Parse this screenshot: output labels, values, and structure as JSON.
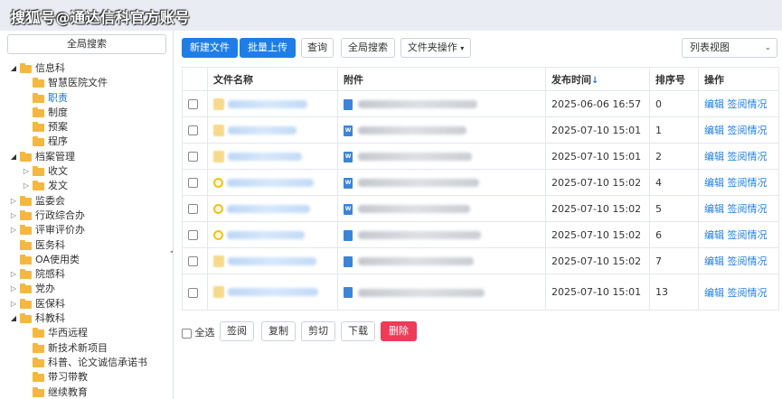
{
  "watermark": "搜狐号@通达信科官方账号",
  "sidebar": {
    "search_label": "全局搜索",
    "tree": [
      {
        "label": "信息科",
        "depth": 0,
        "toggle": "open"
      },
      {
        "label": "智慧医院文件",
        "depth": 1,
        "toggle": "none"
      },
      {
        "label": "职责",
        "depth": 1,
        "toggle": "none",
        "selected": true
      },
      {
        "label": "制度",
        "depth": 1,
        "toggle": "none"
      },
      {
        "label": "预案",
        "depth": 1,
        "toggle": "none"
      },
      {
        "label": "程序",
        "depth": 1,
        "toggle": "none"
      },
      {
        "label": "档案管理",
        "depth": 0,
        "toggle": "open"
      },
      {
        "label": "收文",
        "depth": 1,
        "toggle": "closed"
      },
      {
        "label": "发文",
        "depth": 1,
        "toggle": "closed"
      },
      {
        "label": "监委会",
        "depth": 0,
        "toggle": "closed"
      },
      {
        "label": "行政综合办",
        "depth": 0,
        "toggle": "closed"
      },
      {
        "label": "评审评价办",
        "depth": 0,
        "toggle": "closed"
      },
      {
        "label": "医务科",
        "depth": 0,
        "toggle": "none"
      },
      {
        "label": "OA使用类",
        "depth": 0,
        "toggle": "none"
      },
      {
        "label": "院感科",
        "depth": 0,
        "toggle": "closed"
      },
      {
        "label": "党办",
        "depth": 0,
        "toggle": "closed"
      },
      {
        "label": "医保科",
        "depth": 0,
        "toggle": "closed"
      },
      {
        "label": "科教科",
        "depth": 0,
        "toggle": "open"
      },
      {
        "label": "华西远程",
        "depth": 1,
        "toggle": "none"
      },
      {
        "label": "新技术新项目",
        "depth": 1,
        "toggle": "none"
      },
      {
        "label": "科普、论文诚信承诺书",
        "depth": 1,
        "toggle": "none"
      },
      {
        "label": "带习带教",
        "depth": 1,
        "toggle": "none"
      },
      {
        "label": "继续教育",
        "depth": 1,
        "toggle": "none"
      }
    ]
  },
  "toolbar": {
    "new_file": "新建文件",
    "batch_upload": "批量上传",
    "query": "查询",
    "global_search": "全局搜索",
    "folder_ops": "文件夹操作",
    "view_select": "列表视图"
  },
  "table": {
    "headers": {
      "name": "文件名称",
      "attachment": "附件",
      "publish_time": "发布时间",
      "sort_arrow": "↓",
      "order": "排序号",
      "ops": "操作"
    },
    "rows": [
      {
        "time": "2025-06-06 16:57",
        "order": "0",
        "edit": "编辑",
        "read": "签阅情况",
        "name_icon": "folder",
        "attach_icon": "img"
      },
      {
        "time": "2025-07-10 15:01",
        "order": "1",
        "edit": "编辑",
        "read": "签阅情况",
        "name_icon": "folder",
        "attach_icon": "W"
      },
      {
        "time": "2025-07-10 15:01",
        "order": "2",
        "edit": "编辑",
        "read": "签阅情况",
        "name_icon": "folder",
        "attach_icon": "W"
      },
      {
        "time": "2025-07-10 15:02",
        "order": "4",
        "edit": "编辑",
        "read": "签阅情况",
        "name_icon": "circle",
        "attach_icon": "W"
      },
      {
        "time": "2025-07-10 15:02",
        "order": "5",
        "edit": "编辑",
        "read": "签阅情况",
        "name_icon": "circle",
        "attach_icon": "W"
      },
      {
        "time": "2025-07-10 15:02",
        "order": "6",
        "edit": "编辑",
        "read": "签阅情况",
        "name_icon": "circle",
        "attach_icon": "img"
      },
      {
        "time": "2025-07-10 15:02",
        "order": "7",
        "edit": "编辑",
        "read": "签阅情况",
        "name_icon": "folder",
        "attach_icon": "img"
      },
      {
        "time": "2025-07-10 15:01",
        "order": "13",
        "edit": "编辑",
        "read": "签阅情况",
        "name_icon": "folder",
        "attach_icon": "img"
      }
    ]
  },
  "bottom": {
    "select_all": "全选",
    "sign": "签阅",
    "copy": "复制",
    "cut": "剪切",
    "download": "下载",
    "delete": "删除"
  },
  "colors": {
    "primary": "#1f7ee6",
    "danger": "#ee3b58",
    "folder": "#f4b841"
  }
}
